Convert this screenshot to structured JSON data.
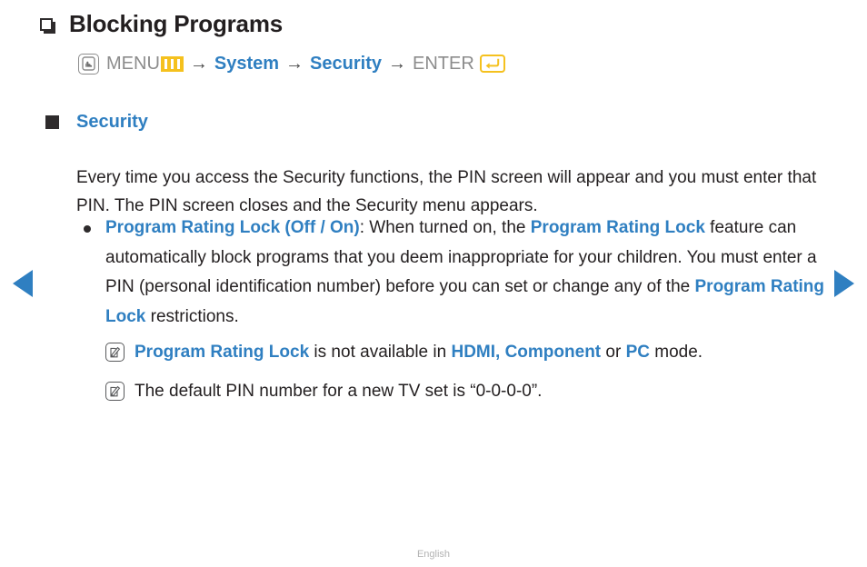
{
  "nav": {
    "prev_label": "previous page",
    "next_label": "next page"
  },
  "header": {
    "title": "Blocking Programs",
    "bullet_icon": "square-outline-shadow-icon"
  },
  "menu_path": {
    "remote_icon": "menu-button-press-icon",
    "menu_label": "MENU",
    "menu_glyph_icon": "menu-bars-icon",
    "arrow_1": "→",
    "system_label": "System",
    "arrow_2": "→",
    "security_label": "Security",
    "arrow_3": "→",
    "enter_label": "ENTER",
    "enter_glyph_icon": "enter-return-icon"
  },
  "section": {
    "bullet_icon": "filled-square-icon",
    "title": "Security",
    "paragraph": "Every time you access the Security functions, the PIN screen will appear and you must enter that PIN. The PIN screen closes and the Security menu appears."
  },
  "bullet": {
    "dot_icon": "bullet-dot-icon",
    "part_1_term": "Program Rating Lock (Off / On)",
    "part_2_text": ": When turned on, the ",
    "part_3_term": "Program Rating Lock",
    "part_4_text": " feature can automatically block programs that you deem inappropriate for your children. You must enter a PIN (personal identification number) before you can set or change any of the ",
    "part_5_term": "Program Rating Lock",
    "part_6_text": " restrictions."
  },
  "notes": [
    {
      "icon": "note-pencil-icon",
      "term_1": "Program Rating Lock",
      "text_1": " is not available in ",
      "term_2": "HDMI, Component",
      "text_2": " or ",
      "term_3": "PC",
      "text_3": " mode."
    },
    {
      "icon": "note-pencil-icon",
      "text": "The default PIN number for a new TV set is “0-0-0-0”."
    }
  ],
  "footer": {
    "language": "English"
  },
  "colors": {
    "accent_blue": "#2f7fc1",
    "gold": "#f5c11e",
    "text_dark": "#231f20",
    "text_gray": "#8c8c8c",
    "footer_gray": "#b3b3b3"
  }
}
